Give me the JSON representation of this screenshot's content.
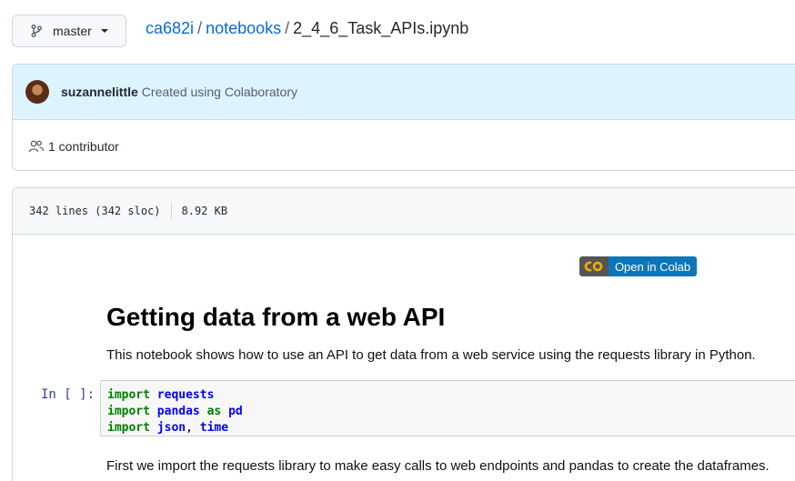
{
  "branch": {
    "label": "master",
    "icon": "git-branch-icon"
  },
  "breadcrumb": {
    "repo": "ca682i",
    "folder": "notebooks",
    "separator": "/",
    "file": "2_4_6_Task_APIs.ipynb"
  },
  "commit": {
    "author": "suzannelittle",
    "message": "Created using Colaboratory"
  },
  "contributors": {
    "label": "1 contributor",
    "icon": "people-icon"
  },
  "file_info": {
    "lines": "342 lines (342 sloc)",
    "size": "8.92 KB"
  },
  "colab_badge": {
    "logo": "CO",
    "label": "Open in Colab"
  },
  "notebook": {
    "title": "Getting data from a web API",
    "intro": "This notebook shows how to use an API to get data from a web service using the requests library in Python.",
    "prompt": "In [ ]:",
    "code": {
      "l1_kw": "import",
      "l1_name": "requests",
      "l2_kw": "import",
      "l2_name": "pandas",
      "l2_as": "as",
      "l2_alias": "pd",
      "l3_kw": "import",
      "l3_name1": "json",
      "l3_comma": ",",
      "l3_name2": "time"
    },
    "after_code": "First we import the requests library to make easy calls to web endpoints and pandas to create the dataframes."
  },
  "colors": {
    "link": "#0969da",
    "commit_bg": "#ddf4ff",
    "badge_blue": "#0e75b6",
    "keyword": "#008000",
    "name": "#0000ff"
  }
}
